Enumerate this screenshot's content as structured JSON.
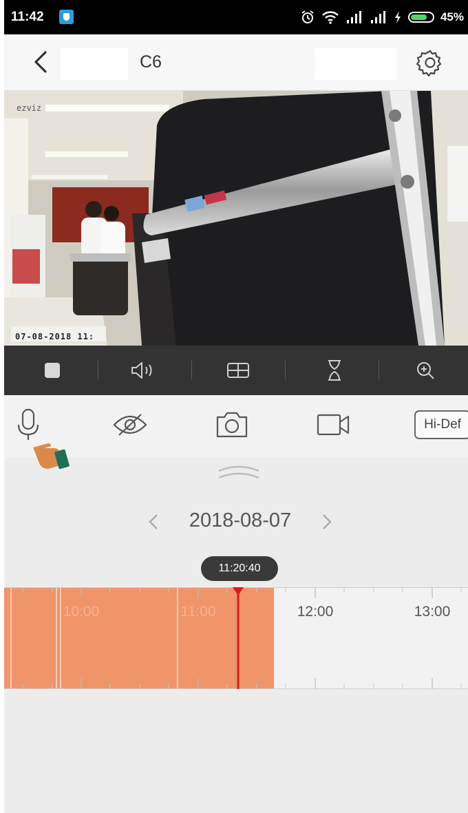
{
  "status_bar": {
    "time": "11:42",
    "battery_pct": "45%",
    "battery_level": 0.45,
    "icons": [
      "app-notification-icon",
      "alarm-icon",
      "wifi-icon",
      "signal-icon",
      "signal-icon",
      "charging-icon",
      "battery-icon"
    ]
  },
  "header": {
    "title": "C6",
    "back_icon": "chevron-left-icon",
    "settings_icon": "gear-icon"
  },
  "video": {
    "watermark": "ezviz",
    "timestamp": "07-08-2018 11:"
  },
  "player_bar": {
    "buttons": [
      "stop-icon",
      "speaker-icon",
      "split-view-icon",
      "hourglass-icon",
      "zoom-in-icon"
    ]
  },
  "controls": {
    "buttons": [
      "microphone-icon",
      "privacy-eye-off-icon",
      "camera-snapshot-icon",
      "video-record-icon"
    ],
    "quality_label": "Hi-Def"
  },
  "date_nav": {
    "date": "2018-08-07",
    "prev_icon": "chevron-left-icon",
    "next_icon": "chevron-right-icon"
  },
  "timeline": {
    "current_time": "11:20:40",
    "hour_labels": [
      "10:00",
      "11:00",
      "12:00",
      "13:00"
    ],
    "recorded_color": "#f0946a",
    "cursor_color": "#e0191b"
  }
}
